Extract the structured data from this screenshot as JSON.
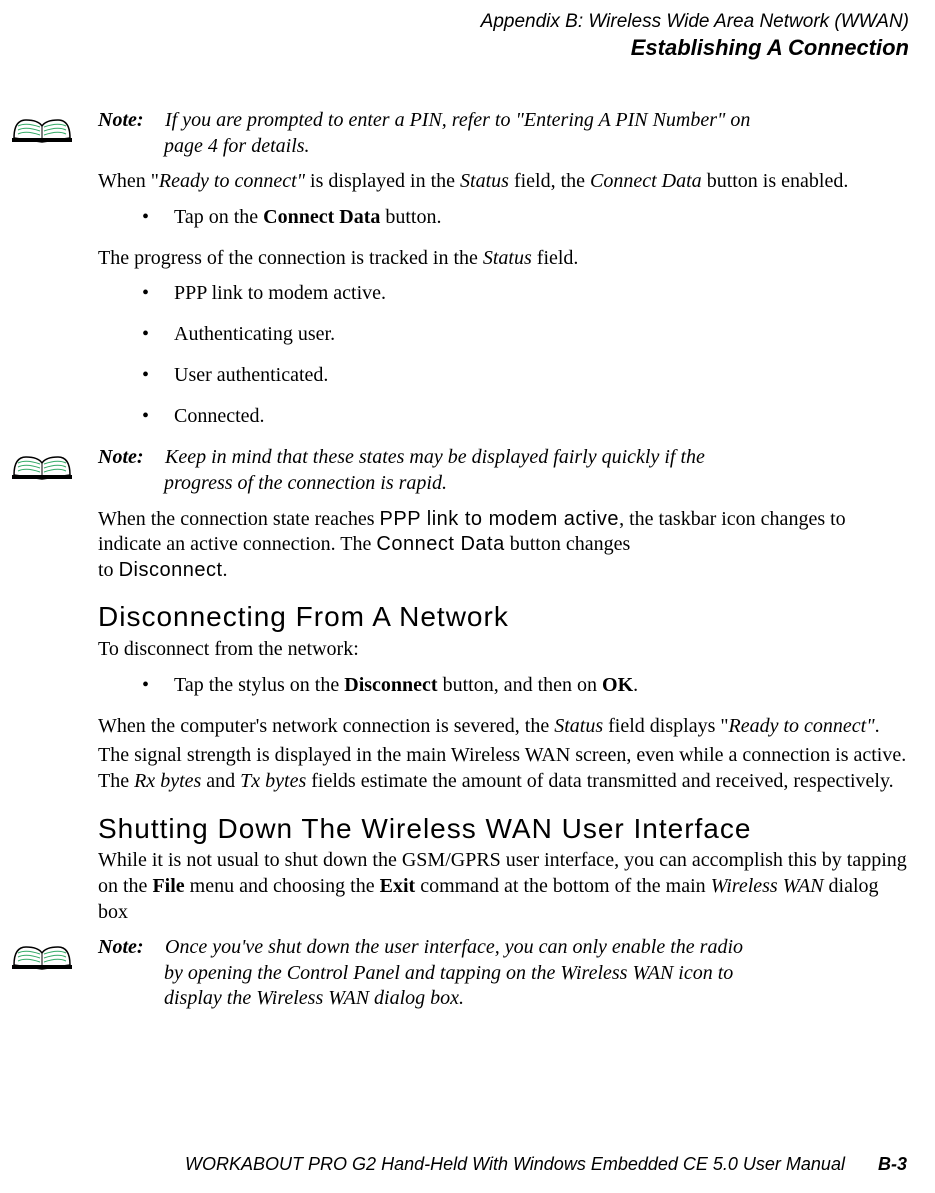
{
  "header": {
    "line1": "Appendix  B:  Wireless Wide Area Network (WWAN)",
    "line2": "Establishing A Connection"
  },
  "notes": {
    "label": "Note:",
    "n1_line1": "If you are prompted to enter a PIN, refer to \"Entering A PIN Number\" on",
    "n1_line2": "page 4 for details.",
    "n2_line1": "Keep in mind that these states may be displayed fairly quickly if the",
    "n2_line2": "progress of the connection is rapid.",
    "n3_line1": "Once you've shut down the user interface, you can only enable the radio",
    "n3_line2": "by opening the Control Panel and tapping on the Wireless WAN icon to",
    "n3_line3": "display the Wireless WAN dialog box."
  },
  "body": {
    "p1_a": "When \"",
    "p1_b": "Ready to connect\"",
    "p1_c": " is displayed in the ",
    "p1_d": "Status",
    "p1_e": " field, the ",
    "p1_f": "Connect Data",
    "p1_g": " button is enabled.",
    "b1": "Tap on the ",
    "b1_bold": "Connect Data",
    "b1_end": " button.",
    "p2_a": "The progress of the connection is tracked in the ",
    "p2_b": "Status",
    "p2_c": " field.",
    "s1": "PPP link to modem active.",
    "s2": "Authenticating user.",
    "s3": "User authenticated.",
    "s4": "Connected.",
    "p3_a": "When the connection state reaches ",
    "p3_b": "PPP link to modem active",
    "p3_c": ", the taskbar icon changes to indicate an active connection. The ",
    "p3_d": "Connect Data",
    "p3_e": " button changes",
    "p3_f": "to ",
    "p3_g": "Disconnect",
    "p3_h": ".",
    "h1": "Disconnecting From A Network",
    "p4": "To disconnect from the network:",
    "b2_a": "Tap the stylus on the ",
    "b2_b": "Disconnect",
    "b2_c": " button, and then on ",
    "b2_d": "OK",
    "b2_e": ".",
    "p5_a": "When the computer's network connection is severed, the ",
    "p5_b": "Status",
    "p5_c": " field displays \"",
    "p5_d": "Ready to connect\"",
    "p5_e": ".",
    "p6_a": "The signal strength is displayed in the main Wireless WAN screen, even while a connection is active. The ",
    "p6_b": "Rx bytes",
    "p6_c": " and ",
    "p6_d": "Tx bytes",
    "p6_e": " fields estimate the amount of data transmitted and received, respectively.",
    "h2": "Shutting Down The Wireless WAN User Interface",
    "p7_a": "While it is not usual to shut down the GSM/GPRS user interface, you can accomplish this by tapping on the ",
    "p7_b": "File",
    "p7_c": " menu and choosing the ",
    "p7_d": "Exit",
    "p7_e": " command at the bottom of the main ",
    "p7_f": "Wireless WAN",
    "p7_g": " dialog box"
  },
  "footer": {
    "title": "WORKABOUT PRO G2 Hand-Held With Windows Embedded CE 5.0 User Manual",
    "page": "B-3"
  }
}
